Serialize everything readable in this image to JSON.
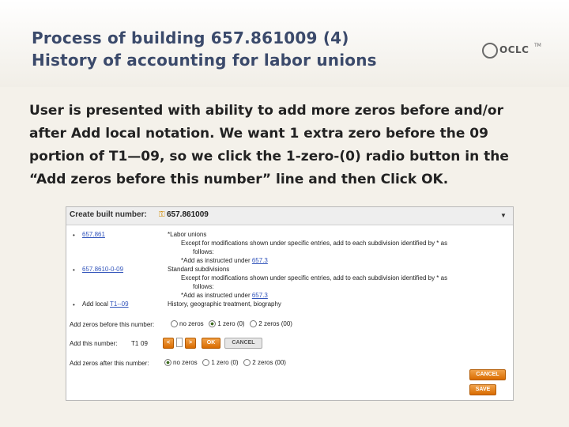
{
  "slide": {
    "title_line1": "Process of building 657.861009 (4)",
    "title_line2": "History of accounting for labor unions",
    "logo_text": "OCLC",
    "logo_tm": "TM",
    "body_lines": [
      "User is presented with ability to add more zeros before and/or",
      "after Add local notation.  We want 1 extra zero before the 09",
      "portion of T1—09, so we click the 1-zero-(0) radio button in the",
      "“Add zeros before this number” line and then Click OK."
    ]
  },
  "app": {
    "create_label": "Create built number:",
    "create_number": "657.861009",
    "rows": [
      {
        "link": "657.861",
        "text": "*Labor unions"
      },
      {
        "text": "Except for modifications shown under specific entries, add to each subdivision identified by * as"
      },
      {
        "text": "follows:"
      },
      {
        "text": "*Add as instructed under ",
        "link": "657.3"
      },
      {
        "link": "657.8610-0-09",
        "text": "Standard subdivisions"
      },
      {
        "text": "Except for modifications shown under specific entries, add to each subdivision identified by * as"
      },
      {
        "text": "follows:"
      },
      {
        "text": "*Add as instructed under ",
        "link": "657.3"
      },
      {
        "label": "Add local",
        "link": "T1--09",
        "text": "History, geographic treatment, biography"
      }
    ],
    "zeros_before_label": "Add zeros before this number:",
    "zeros_before_options": [
      "no zeros",
      "1 zero (0)",
      "2 zeros (00)"
    ],
    "add_number_label": "Add this number:",
    "add_number_value": "T1",
    "add_number_suffix": "09",
    "btn_prev": "<",
    "btn_next": ">",
    "btn_ok": "OK",
    "btn_cancel": "CANCEL",
    "zeros_after_label": "Add zeros after this number:",
    "zeros_after_options": [
      "no zeros",
      "1 zero (0)",
      "2 zeros (00)"
    ],
    "side_cancel": "CANCEL",
    "side_save": "SAVE"
  }
}
